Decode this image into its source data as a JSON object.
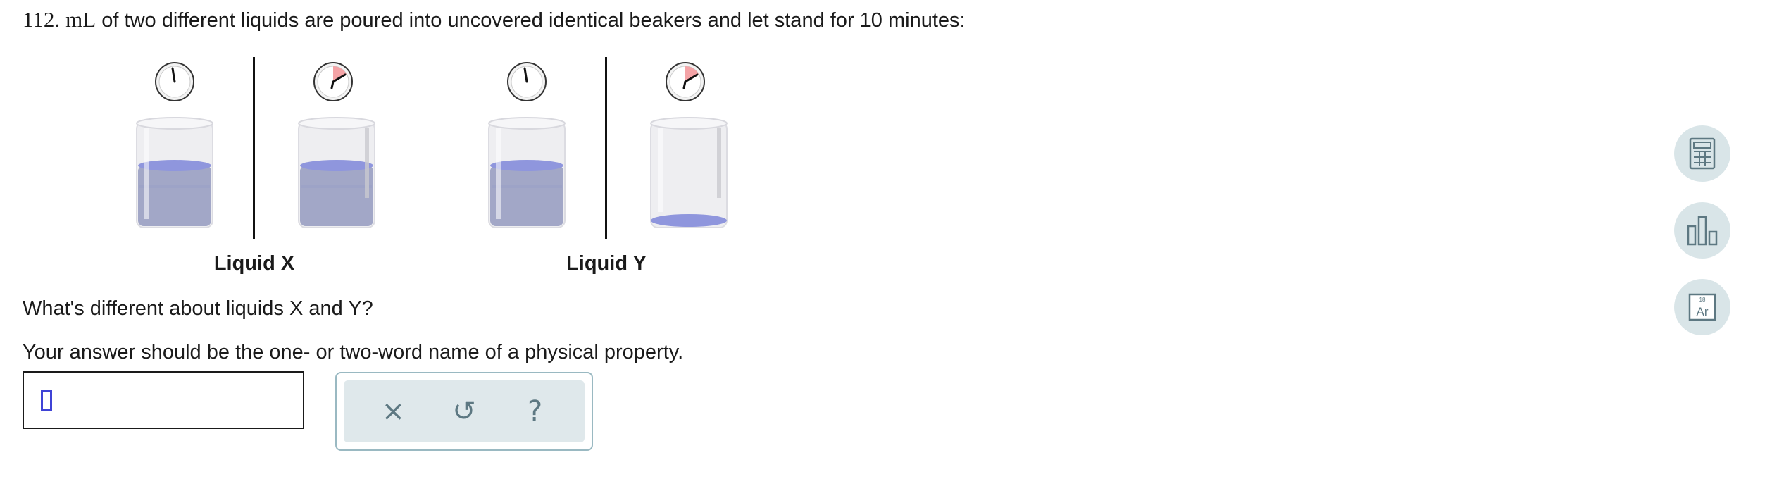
{
  "question": {
    "number": "112.",
    "unit": "mL",
    "text": "of two different liquids are poured into uncovered identical beakers and let stand for 10 minutes:"
  },
  "experiment": {
    "liquids": [
      {
        "label": "Liquid X",
        "start_level": "high",
        "end_level": "high"
      },
      {
        "label": "Liquid Y",
        "start_level": "high",
        "end_level": "nearly empty"
      }
    ],
    "colors": {
      "liquid": "#9fa6e0",
      "glass": "#e8e8ec",
      "clock_elapsed": "#f4a3a6"
    }
  },
  "prompts": {
    "line1": "What's different about liquids X and Y?",
    "line2": "Your answer should be the one- or two-word name of a physical property."
  },
  "answer": {
    "value": ""
  },
  "toolbar": {
    "buttons": [
      {
        "icon": "close-icon",
        "glyph": "×"
      },
      {
        "icon": "undo-icon",
        "glyph": "↺"
      },
      {
        "icon": "help-icon",
        "glyph": "?"
      }
    ]
  },
  "side_tools": [
    {
      "icon": "calculator-icon"
    },
    {
      "icon": "bar-chart-icon"
    },
    {
      "icon": "periodic-table-icon",
      "small": "18",
      "symbol": "Ar"
    }
  ]
}
